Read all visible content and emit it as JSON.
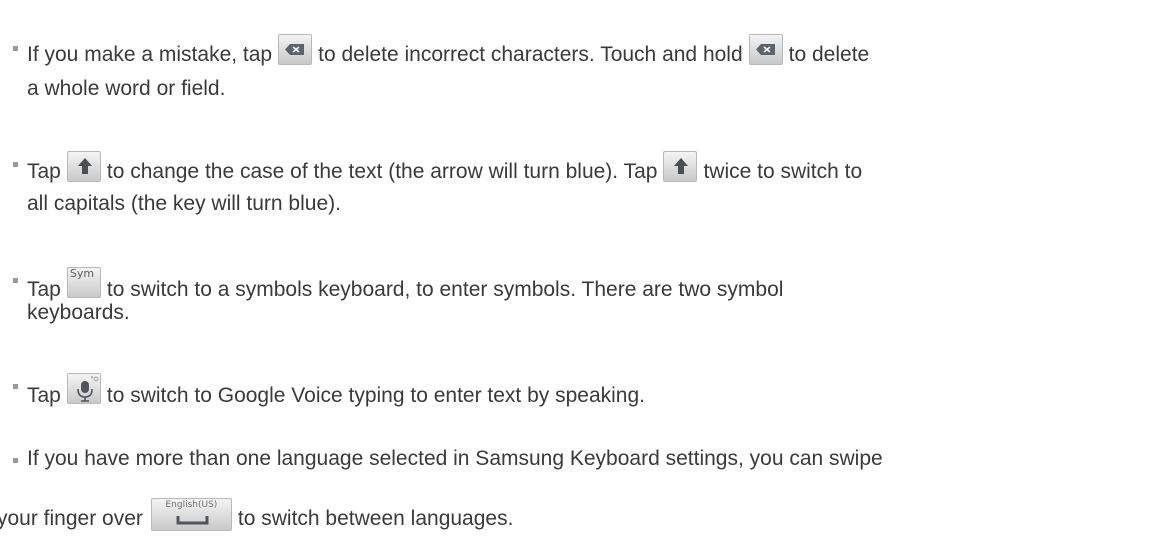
{
  "bullets": [
    {
      "line1": {
        "a": "If you make a mistake, tap",
        "b": "to delete incorrect characters. Touch and hold",
        "c": "to delete"
      },
      "line2": "a whole word or field.",
      "icons": [
        "backspace-key-icon",
        "backspace-key-icon"
      ]
    },
    {
      "line1": {
        "a": "Tap",
        "b": "to change the case of the text (the arrow will turn blue). Tap",
        "c": "twice to switch to"
      },
      "line2": "all capitals (the key will turn blue).",
      "icons": [
        "shift-key-icon",
        "shift-key-icon"
      ]
    },
    {
      "line1": {
        "a": "Tap",
        "b": "to switch to a symbols keyboard, to enter symbols. There are two symbol"
      },
      "line2": "keyboards.",
      "key_label": "Sym",
      "icons": [
        "sym-key-icon"
      ]
    },
    {
      "line1": {
        "a": "Tap",
        "b": "to switch to Google Voice typing to enter text by speaking."
      },
      "icons": [
        "microphone-key-icon"
      ]
    },
    {
      "line1": "If you have more than one language selected in Samsung Keyboard settings, you can swipe",
      "line2": {
        "a": "your finger over",
        "b": "to switch between languages."
      },
      "key_label": "English(US)",
      "icons": [
        "space-bar-key-icon"
      ]
    }
  ]
}
